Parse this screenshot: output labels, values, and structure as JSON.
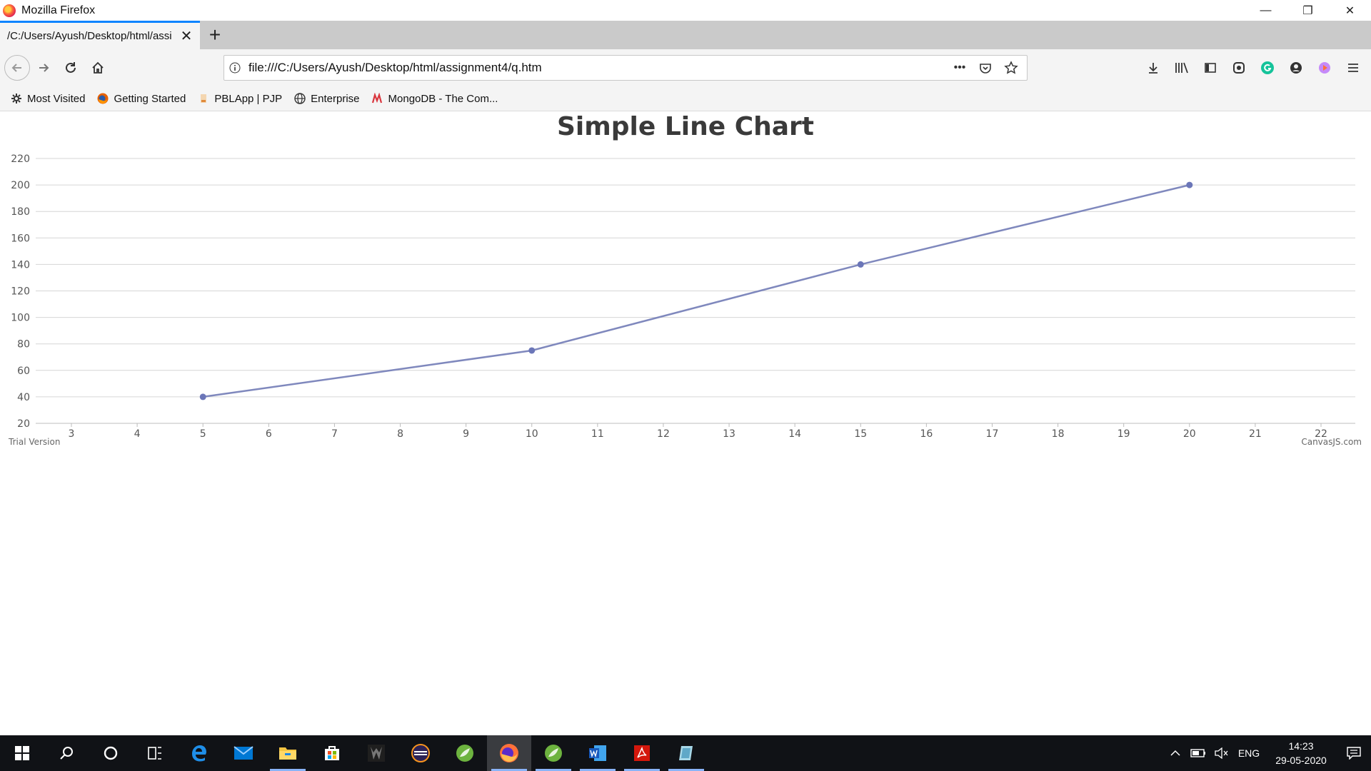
{
  "window": {
    "title": "Mozilla Firefox",
    "controls": {
      "minimize": "—",
      "restore": "❐",
      "close": "✕"
    }
  },
  "tab": {
    "title": "/C:/Users/Ayush/Desktop/html/assi",
    "close": "✕",
    "new_tab": "+"
  },
  "nav": {
    "url": "file:///C:/Users/Ayush/Desktop/html/assignment4/q.htm",
    "page_actions": "•••"
  },
  "bookmarks": [
    {
      "label": "Most Visited",
      "icon": "gear-icon"
    },
    {
      "label": "Getting Started",
      "icon": "firefox-icon"
    },
    {
      "label": "PBLApp | PJP",
      "icon": "pbl-icon"
    },
    {
      "label": "Enterprise",
      "icon": "globe-icon"
    },
    {
      "label": "MongoDB - The Com...",
      "icon": "mongodb-icon"
    }
  ],
  "chart_data": {
    "type": "line",
    "title": "Simple Line Chart",
    "x": [
      5,
      10,
      15,
      20
    ],
    "y": [
      40,
      75,
      140,
      200
    ],
    "xlim": [
      3,
      22
    ],
    "ylim": [
      20,
      220
    ],
    "x_ticks": [
      3,
      4,
      5,
      6,
      7,
      8,
      9,
      10,
      11,
      12,
      13,
      14,
      15,
      16,
      17,
      18,
      19,
      20,
      21,
      22
    ],
    "y_ticks": [
      20,
      40,
      60,
      80,
      100,
      120,
      140,
      160,
      180,
      200,
      220
    ],
    "grid": "horizontal",
    "line_color": "#7f88bd",
    "watermark_left": "Trial Version",
    "watermark_right": "CanvasJS.com"
  },
  "taskbar": {
    "apps": [
      "start-icon",
      "search-icon",
      "cortana-icon",
      "task-view-icon",
      "edge-icon",
      "mail-icon",
      "file-explorer-icon",
      "store-icon",
      "predator-icon",
      "eclipse-icon",
      "spring-icon",
      "firefox-icon",
      "spring-tool-icon",
      "word-icon",
      "acrobat-icon",
      "other-app-icon"
    ],
    "language": "ENG",
    "time": "14:23",
    "date": "29-05-2020"
  }
}
